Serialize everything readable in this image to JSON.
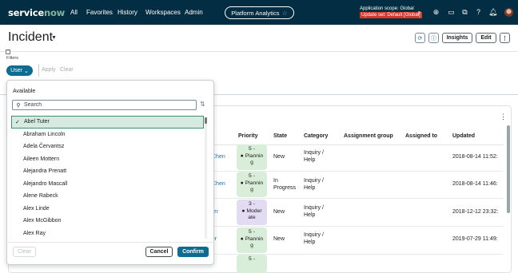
{
  "topnav": {
    "logo": "servicenow",
    "items": [
      "All",
      "Favorites",
      "History",
      "Workspaces",
      "Admin"
    ],
    "platform_analytics": "Platform Analytics",
    "scope_line1": "Application scope: Global",
    "scope_line2": "Update set: Default [Global]",
    "icons": [
      "search-icon",
      "globe-icon",
      "chat-icon",
      "collab-icon",
      "help-icon",
      "bell-icon",
      "user-avatar"
    ]
  },
  "header": {
    "title": "Incident",
    "buttons": {
      "insights": "Insights",
      "edit": "Edit"
    }
  },
  "filters": {
    "label": "Filters",
    "user_pill": "User",
    "apply": "Apply",
    "clear": "Clear"
  },
  "dropdown": {
    "title": "Available",
    "search_placeholder": "Search",
    "items": [
      "Abel Tuter",
      "Abraham Lincoln",
      "Adela Červantsz",
      "Aileen Mottern",
      "Alejandra Prenatt",
      "Alejandro Mascall",
      "Alene Rabeck",
      "Alex Linde",
      "Alex McGibbon",
      "Alex Ray"
    ],
    "selected_index": 0,
    "buttons": {
      "clear": "Clear",
      "cancel": "Cancel",
      "confirm": "Confirm"
    }
  },
  "table": {
    "columns": [
      "Priority",
      "State",
      "Category",
      "Assignment group",
      "Assigned to",
      "Updated"
    ],
    "rows": [
      {
        "caller_fragment": "Chen",
        "priority_num": "5 -",
        "priority_l2": "● Plannin",
        "priority_l3": "g",
        "priority_kind": "plan",
        "state_l1": "New",
        "state_l2": "",
        "category_l1": "Inquiry /",
        "category_l2": "Help",
        "assignment_group": "",
        "assigned_to": "",
        "updated": "2018-08-14 11:52:"
      },
      {
        "caller_fragment": "Chen",
        "priority_num": "5 -",
        "priority_l2": "● Plannin",
        "priority_l3": "g",
        "priority_kind": "plan",
        "state_l1": "In",
        "state_l2": "Progress",
        "category_l1": "Inquiry /",
        "category_l2": "Help",
        "assignment_group": "",
        "assigned_to": "",
        "updated": "2018-08-14 11:46:"
      },
      {
        "caller_fragment": "ler",
        "priority_num": "3 -",
        "priority_l2": "● Moder",
        "priority_l3": "ate",
        "priority_kind": "mod",
        "state_l1": "New",
        "state_l2": "",
        "category_l1": "Inquiry /",
        "category_l2": "Help",
        "assignment_group": "",
        "assigned_to": "",
        "updated": "2018-12-12 23:32:"
      },
      {
        "caller_fragment": "er",
        "priority_num": "5 -",
        "priority_l2": "● Plannin",
        "priority_l3": "g",
        "priority_kind": "plan",
        "state_l1": "New",
        "state_l2": "",
        "category_l1": "Inquiry /",
        "category_l2": "Help",
        "assignment_group": "",
        "assigned_to": "",
        "updated": "2019-07-29 11:49:"
      },
      {
        "caller_fragment": "",
        "priority_num": "5 -",
        "priority_l2": "",
        "priority_l3": "",
        "priority_kind": "plan",
        "state_l1": "",
        "state_l2": "",
        "category_l1": "",
        "category_l2": "",
        "assignment_group": "",
        "assigned_to": "",
        "updated": ""
      }
    ]
  },
  "colors": {
    "nav_bg": "#032d42",
    "accent": "#0d6d90",
    "planning_badge": "#d9eed9",
    "moderate_badge": "#e2dcf3",
    "update_set_bg": "#d6372d"
  }
}
